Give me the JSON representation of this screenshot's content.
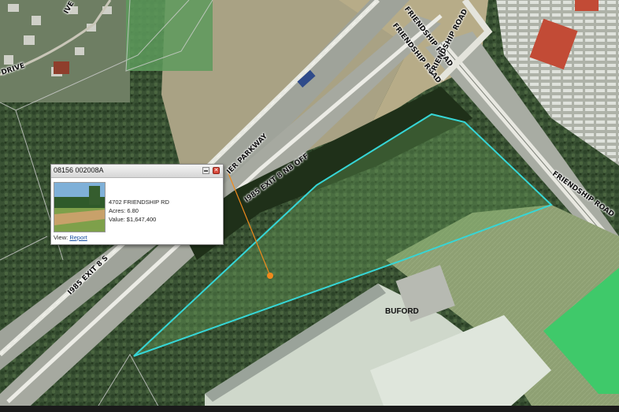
{
  "map": {
    "road_labels": {
      "friendship_road_1": "FRIENDSHIP ROAD",
      "friendship_road_2": "FRIENDSHIP ROAD",
      "friendship_road_3": "FRIENDSHIP ROAD",
      "friendship_road_4": "FRIENDSHIP ROAD",
      "ier_parkway": "IER PARKWAY",
      "i985_exit_nb": "I985 EXIT 8 NB OFF",
      "i985_exit_sb": "I985 EXIT 8 S",
      "drive": "DRIVE",
      "ive": "IVE"
    },
    "city_label": "BUFORD",
    "colors": {
      "parcel_outline": "#36d6d6",
      "selected_parcel_fill": "#3fc96a",
      "leader_line": "#f08a1c"
    }
  },
  "popup": {
    "parcel_id": "08156 002008A",
    "address": "4702 FRIENDSHIP RD",
    "acres_label": "Acres: 6.80",
    "value_label": "Value: $1,647,400",
    "view_prefix": "View:",
    "report_link": "Report",
    "minimize_icon": "minimize-icon",
    "close_icon": "close-icon"
  }
}
